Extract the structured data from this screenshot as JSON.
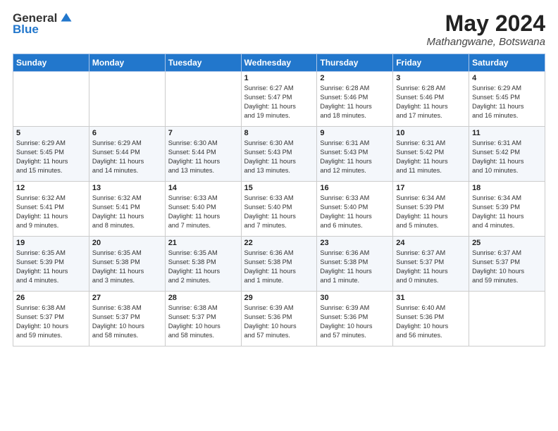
{
  "logo": {
    "general": "General",
    "blue": "Blue"
  },
  "title": {
    "month": "May 2024",
    "location": "Mathangwane, Botswana"
  },
  "weekdays": [
    "Sunday",
    "Monday",
    "Tuesday",
    "Wednesday",
    "Thursday",
    "Friday",
    "Saturday"
  ],
  "weeks": [
    [
      {
        "day": "",
        "info": ""
      },
      {
        "day": "",
        "info": ""
      },
      {
        "day": "",
        "info": ""
      },
      {
        "day": "1",
        "info": "Sunrise: 6:27 AM\nSunset: 5:47 PM\nDaylight: 11 hours\nand 19 minutes."
      },
      {
        "day": "2",
        "info": "Sunrise: 6:28 AM\nSunset: 5:46 PM\nDaylight: 11 hours\nand 18 minutes."
      },
      {
        "day": "3",
        "info": "Sunrise: 6:28 AM\nSunset: 5:46 PM\nDaylight: 11 hours\nand 17 minutes."
      },
      {
        "day": "4",
        "info": "Sunrise: 6:29 AM\nSunset: 5:45 PM\nDaylight: 11 hours\nand 16 minutes."
      }
    ],
    [
      {
        "day": "5",
        "info": "Sunrise: 6:29 AM\nSunset: 5:45 PM\nDaylight: 11 hours\nand 15 minutes."
      },
      {
        "day": "6",
        "info": "Sunrise: 6:29 AM\nSunset: 5:44 PM\nDaylight: 11 hours\nand 14 minutes."
      },
      {
        "day": "7",
        "info": "Sunrise: 6:30 AM\nSunset: 5:44 PM\nDaylight: 11 hours\nand 13 minutes."
      },
      {
        "day": "8",
        "info": "Sunrise: 6:30 AM\nSunset: 5:43 PM\nDaylight: 11 hours\nand 13 minutes."
      },
      {
        "day": "9",
        "info": "Sunrise: 6:31 AM\nSunset: 5:43 PM\nDaylight: 11 hours\nand 12 minutes."
      },
      {
        "day": "10",
        "info": "Sunrise: 6:31 AM\nSunset: 5:42 PM\nDaylight: 11 hours\nand 11 minutes."
      },
      {
        "day": "11",
        "info": "Sunrise: 6:31 AM\nSunset: 5:42 PM\nDaylight: 11 hours\nand 10 minutes."
      }
    ],
    [
      {
        "day": "12",
        "info": "Sunrise: 6:32 AM\nSunset: 5:41 PM\nDaylight: 11 hours\nand 9 minutes."
      },
      {
        "day": "13",
        "info": "Sunrise: 6:32 AM\nSunset: 5:41 PM\nDaylight: 11 hours\nand 8 minutes."
      },
      {
        "day": "14",
        "info": "Sunrise: 6:33 AM\nSunset: 5:40 PM\nDaylight: 11 hours\nand 7 minutes."
      },
      {
        "day": "15",
        "info": "Sunrise: 6:33 AM\nSunset: 5:40 PM\nDaylight: 11 hours\nand 7 minutes."
      },
      {
        "day": "16",
        "info": "Sunrise: 6:33 AM\nSunset: 5:40 PM\nDaylight: 11 hours\nand 6 minutes."
      },
      {
        "day": "17",
        "info": "Sunrise: 6:34 AM\nSunset: 5:39 PM\nDaylight: 11 hours\nand 5 minutes."
      },
      {
        "day": "18",
        "info": "Sunrise: 6:34 AM\nSunset: 5:39 PM\nDaylight: 11 hours\nand 4 minutes."
      }
    ],
    [
      {
        "day": "19",
        "info": "Sunrise: 6:35 AM\nSunset: 5:39 PM\nDaylight: 11 hours\nand 4 minutes."
      },
      {
        "day": "20",
        "info": "Sunrise: 6:35 AM\nSunset: 5:38 PM\nDaylight: 11 hours\nand 3 minutes."
      },
      {
        "day": "21",
        "info": "Sunrise: 6:35 AM\nSunset: 5:38 PM\nDaylight: 11 hours\nand 2 minutes."
      },
      {
        "day": "22",
        "info": "Sunrise: 6:36 AM\nSunset: 5:38 PM\nDaylight: 11 hours\nand 1 minute."
      },
      {
        "day": "23",
        "info": "Sunrise: 6:36 AM\nSunset: 5:38 PM\nDaylight: 11 hours\nand 1 minute."
      },
      {
        "day": "24",
        "info": "Sunrise: 6:37 AM\nSunset: 5:37 PM\nDaylight: 11 hours\nand 0 minutes."
      },
      {
        "day": "25",
        "info": "Sunrise: 6:37 AM\nSunset: 5:37 PM\nDaylight: 10 hours\nand 59 minutes."
      }
    ],
    [
      {
        "day": "26",
        "info": "Sunrise: 6:38 AM\nSunset: 5:37 PM\nDaylight: 10 hours\nand 59 minutes."
      },
      {
        "day": "27",
        "info": "Sunrise: 6:38 AM\nSunset: 5:37 PM\nDaylight: 10 hours\nand 58 minutes."
      },
      {
        "day": "28",
        "info": "Sunrise: 6:38 AM\nSunset: 5:37 PM\nDaylight: 10 hours\nand 58 minutes."
      },
      {
        "day": "29",
        "info": "Sunrise: 6:39 AM\nSunset: 5:36 PM\nDaylight: 10 hours\nand 57 minutes."
      },
      {
        "day": "30",
        "info": "Sunrise: 6:39 AM\nSunset: 5:36 PM\nDaylight: 10 hours\nand 57 minutes."
      },
      {
        "day": "31",
        "info": "Sunrise: 6:40 AM\nSunset: 5:36 PM\nDaylight: 10 hours\nand 56 minutes."
      },
      {
        "day": "",
        "info": ""
      }
    ]
  ]
}
